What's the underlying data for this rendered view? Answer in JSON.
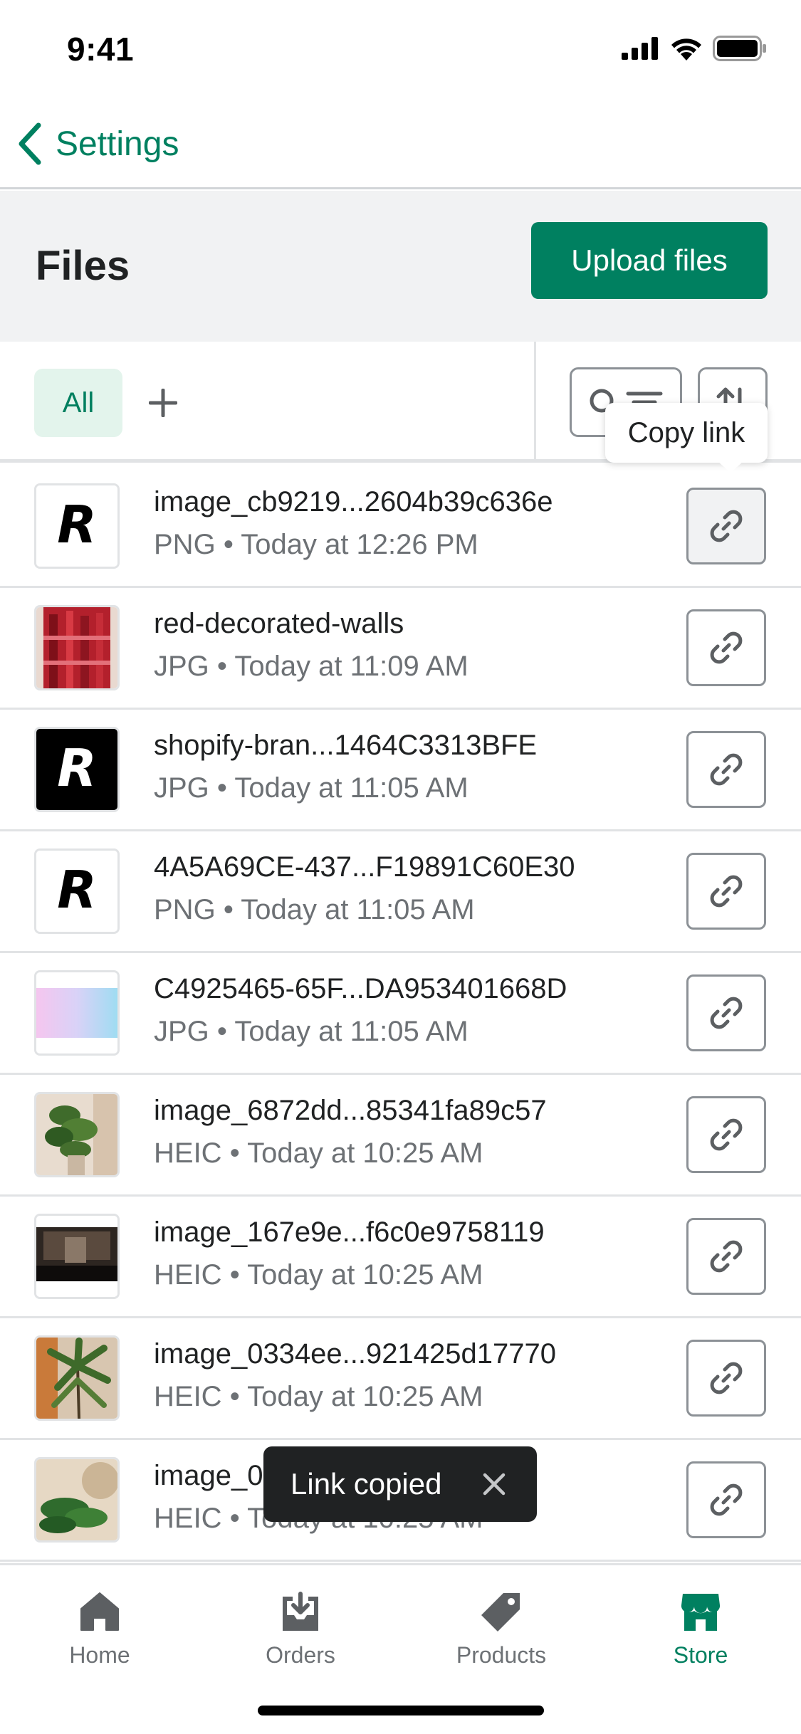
{
  "status_bar": {
    "time": "9:41"
  },
  "nav": {
    "back_label": "Settings"
  },
  "header": {
    "title": "Files",
    "upload_label": "Upload files"
  },
  "filters": {
    "tab_all": "All"
  },
  "tooltip": {
    "text": "Copy link"
  },
  "files": [
    {
      "name": "image_cb9219...2604b39c636e",
      "type": "PNG",
      "date": "Today at 12:26 PM",
      "thumb": "logo-light"
    },
    {
      "name": "red-decorated-walls",
      "type": "JPG",
      "date": "Today at 11:09 AM",
      "thumb": "photo-red"
    },
    {
      "name": "shopify-bran...1464C3313BFE",
      "type": "JPG",
      "date": "Today at 11:05 AM",
      "thumb": "logo-dark"
    },
    {
      "name": "4A5A69CE-437...F19891C60E30",
      "type": "PNG",
      "date": "Today at 11:05 AM",
      "thumb": "logo-light"
    },
    {
      "name": "C4925465-65F...DA953401668D",
      "type": "JPG",
      "date": "Today at 11:05 AM",
      "thumb": "gradient"
    },
    {
      "name": "image_6872dd...85341fa89c57",
      "type": "HEIC",
      "date": "Today at 10:25 AM",
      "thumb": "photo-plant"
    },
    {
      "name": "image_167e9e...f6c0e9758119",
      "type": "HEIC",
      "date": "Today at 10:25 AM",
      "thumb": "photo-dark"
    },
    {
      "name": "image_0334ee...921425d17770",
      "type": "HEIC",
      "date": "Today at 10:25 AM",
      "thumb": "photo-palm"
    },
    {
      "name": "image_0                                       3c86",
      "type": "HEIC",
      "date": "Today at 10:25 AM",
      "thumb": "photo-leaf"
    }
  ],
  "meta_separator": "•",
  "toast": {
    "text": "Link copied"
  },
  "tab_bar": {
    "home": "Home",
    "orders": "Orders",
    "products": "Products",
    "store": "Store"
  },
  "colors": {
    "primary": "#008060",
    "header_bg": "#f1f2f3",
    "text": "#202223",
    "subdued": "#6d7175",
    "border": "#e1e3e5"
  }
}
